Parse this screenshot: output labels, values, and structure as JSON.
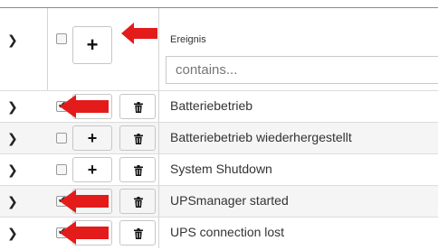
{
  "header": {
    "column_label": "Ereignis",
    "filter": {
      "placeholder": "contains...",
      "value": ""
    }
  },
  "rows": [
    {
      "label": "Batteriebetrieb",
      "checked": true,
      "action": "none",
      "arrow": true
    },
    {
      "label": "Batteriebetrieb wiederhergestellt",
      "checked": false,
      "action": "plus",
      "arrow": false
    },
    {
      "label": "System Shutdown",
      "checked": false,
      "action": "plus",
      "arrow": false
    },
    {
      "label": "UPSmanager started",
      "checked": true,
      "action": "none",
      "arrow": true
    },
    {
      "label": "UPS connection lost",
      "checked": true,
      "action": "none",
      "arrow": true
    }
  ],
  "colors": {
    "arrow": "#e31b1b",
    "gridline": "#dcdcdc",
    "row_alt": "#f5f5f5"
  },
  "icons": [
    "chevron-right-icon",
    "checkbox",
    "plus-icon",
    "trash-icon",
    "red-arrow-annotation"
  ]
}
